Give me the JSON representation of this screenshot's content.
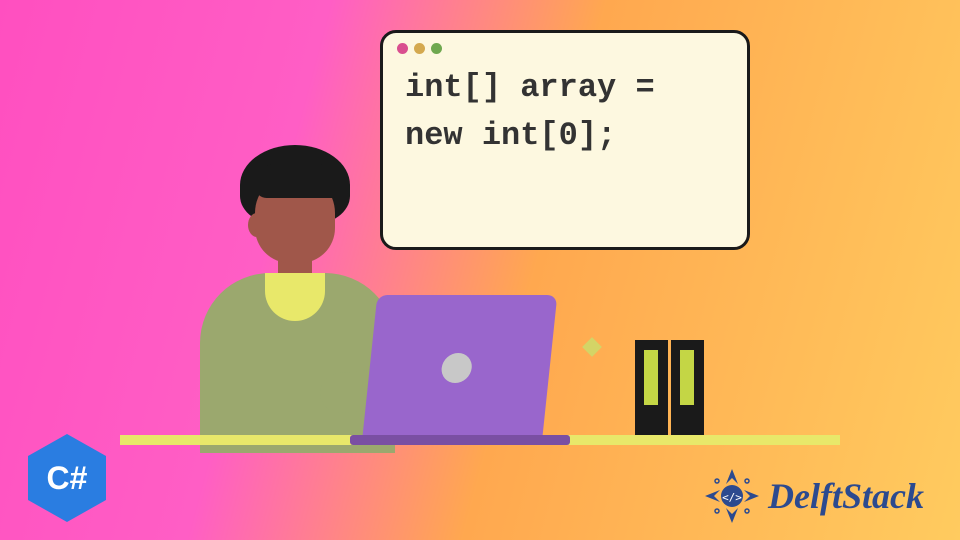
{
  "code": {
    "line1": "int[] array =",
    "line2": "new int[0];"
  },
  "badges": {
    "csharp": "C#"
  },
  "brand": {
    "name": "DelftStack"
  }
}
